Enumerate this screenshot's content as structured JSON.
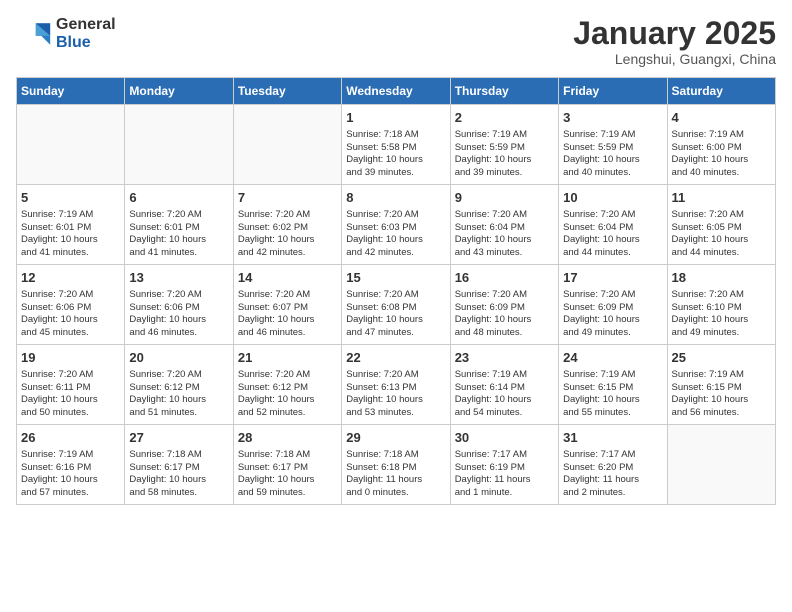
{
  "logo": {
    "line1": "General",
    "line2": "Blue"
  },
  "title": "January 2025",
  "subtitle": "Lengshui, Guangxi, China",
  "weekdays": [
    "Sunday",
    "Monday",
    "Tuesday",
    "Wednesday",
    "Thursday",
    "Friday",
    "Saturday"
  ],
  "weeks": [
    [
      {
        "day": "",
        "info": ""
      },
      {
        "day": "",
        "info": ""
      },
      {
        "day": "",
        "info": ""
      },
      {
        "day": "1",
        "info": "Sunrise: 7:18 AM\nSunset: 5:58 PM\nDaylight: 10 hours\nand 39 minutes."
      },
      {
        "day": "2",
        "info": "Sunrise: 7:19 AM\nSunset: 5:59 PM\nDaylight: 10 hours\nand 39 minutes."
      },
      {
        "day": "3",
        "info": "Sunrise: 7:19 AM\nSunset: 5:59 PM\nDaylight: 10 hours\nand 40 minutes."
      },
      {
        "day": "4",
        "info": "Sunrise: 7:19 AM\nSunset: 6:00 PM\nDaylight: 10 hours\nand 40 minutes."
      }
    ],
    [
      {
        "day": "5",
        "info": "Sunrise: 7:19 AM\nSunset: 6:01 PM\nDaylight: 10 hours\nand 41 minutes."
      },
      {
        "day": "6",
        "info": "Sunrise: 7:20 AM\nSunset: 6:01 PM\nDaylight: 10 hours\nand 41 minutes."
      },
      {
        "day": "7",
        "info": "Sunrise: 7:20 AM\nSunset: 6:02 PM\nDaylight: 10 hours\nand 42 minutes."
      },
      {
        "day": "8",
        "info": "Sunrise: 7:20 AM\nSunset: 6:03 PM\nDaylight: 10 hours\nand 42 minutes."
      },
      {
        "day": "9",
        "info": "Sunrise: 7:20 AM\nSunset: 6:04 PM\nDaylight: 10 hours\nand 43 minutes."
      },
      {
        "day": "10",
        "info": "Sunrise: 7:20 AM\nSunset: 6:04 PM\nDaylight: 10 hours\nand 44 minutes."
      },
      {
        "day": "11",
        "info": "Sunrise: 7:20 AM\nSunset: 6:05 PM\nDaylight: 10 hours\nand 44 minutes."
      }
    ],
    [
      {
        "day": "12",
        "info": "Sunrise: 7:20 AM\nSunset: 6:06 PM\nDaylight: 10 hours\nand 45 minutes."
      },
      {
        "day": "13",
        "info": "Sunrise: 7:20 AM\nSunset: 6:06 PM\nDaylight: 10 hours\nand 46 minutes."
      },
      {
        "day": "14",
        "info": "Sunrise: 7:20 AM\nSunset: 6:07 PM\nDaylight: 10 hours\nand 46 minutes."
      },
      {
        "day": "15",
        "info": "Sunrise: 7:20 AM\nSunset: 6:08 PM\nDaylight: 10 hours\nand 47 minutes."
      },
      {
        "day": "16",
        "info": "Sunrise: 7:20 AM\nSunset: 6:09 PM\nDaylight: 10 hours\nand 48 minutes."
      },
      {
        "day": "17",
        "info": "Sunrise: 7:20 AM\nSunset: 6:09 PM\nDaylight: 10 hours\nand 49 minutes."
      },
      {
        "day": "18",
        "info": "Sunrise: 7:20 AM\nSunset: 6:10 PM\nDaylight: 10 hours\nand 49 minutes."
      }
    ],
    [
      {
        "day": "19",
        "info": "Sunrise: 7:20 AM\nSunset: 6:11 PM\nDaylight: 10 hours\nand 50 minutes."
      },
      {
        "day": "20",
        "info": "Sunrise: 7:20 AM\nSunset: 6:12 PM\nDaylight: 10 hours\nand 51 minutes."
      },
      {
        "day": "21",
        "info": "Sunrise: 7:20 AM\nSunset: 6:12 PM\nDaylight: 10 hours\nand 52 minutes."
      },
      {
        "day": "22",
        "info": "Sunrise: 7:20 AM\nSunset: 6:13 PM\nDaylight: 10 hours\nand 53 minutes."
      },
      {
        "day": "23",
        "info": "Sunrise: 7:19 AM\nSunset: 6:14 PM\nDaylight: 10 hours\nand 54 minutes."
      },
      {
        "day": "24",
        "info": "Sunrise: 7:19 AM\nSunset: 6:15 PM\nDaylight: 10 hours\nand 55 minutes."
      },
      {
        "day": "25",
        "info": "Sunrise: 7:19 AM\nSunset: 6:15 PM\nDaylight: 10 hours\nand 56 minutes."
      }
    ],
    [
      {
        "day": "26",
        "info": "Sunrise: 7:19 AM\nSunset: 6:16 PM\nDaylight: 10 hours\nand 57 minutes."
      },
      {
        "day": "27",
        "info": "Sunrise: 7:18 AM\nSunset: 6:17 PM\nDaylight: 10 hours\nand 58 minutes."
      },
      {
        "day": "28",
        "info": "Sunrise: 7:18 AM\nSunset: 6:17 PM\nDaylight: 10 hours\nand 59 minutes."
      },
      {
        "day": "29",
        "info": "Sunrise: 7:18 AM\nSunset: 6:18 PM\nDaylight: 11 hours\nand 0 minutes."
      },
      {
        "day": "30",
        "info": "Sunrise: 7:17 AM\nSunset: 6:19 PM\nDaylight: 11 hours\nand 1 minute."
      },
      {
        "day": "31",
        "info": "Sunrise: 7:17 AM\nSunset: 6:20 PM\nDaylight: 11 hours\nand 2 minutes."
      },
      {
        "day": "",
        "info": ""
      }
    ]
  ]
}
